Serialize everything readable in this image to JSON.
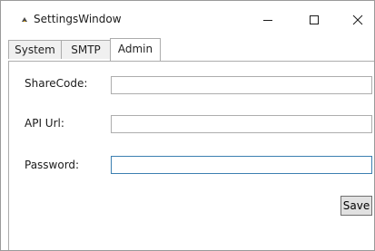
{
  "window": {
    "title": "SettingsWindow",
    "icon": "app-icon"
  },
  "titlebar": {
    "minimize_glyph": "—",
    "maximize_glyph": "☐",
    "close_glyph": "✕"
  },
  "tabs": [
    {
      "label": "System",
      "selected": false
    },
    {
      "label": "SMTP",
      "selected": false
    },
    {
      "label": "Admin",
      "selected": true
    }
  ],
  "form": {
    "sharecode_label": "ShareCode:",
    "sharecode_value": "",
    "apiurl_label": "API Url:",
    "apiurl_value": "",
    "password_label": "Password:",
    "password_value": "",
    "save_label": "Save"
  },
  "colors": {
    "focus_border": "#3c7fb1",
    "tab_border": "#acacac"
  }
}
